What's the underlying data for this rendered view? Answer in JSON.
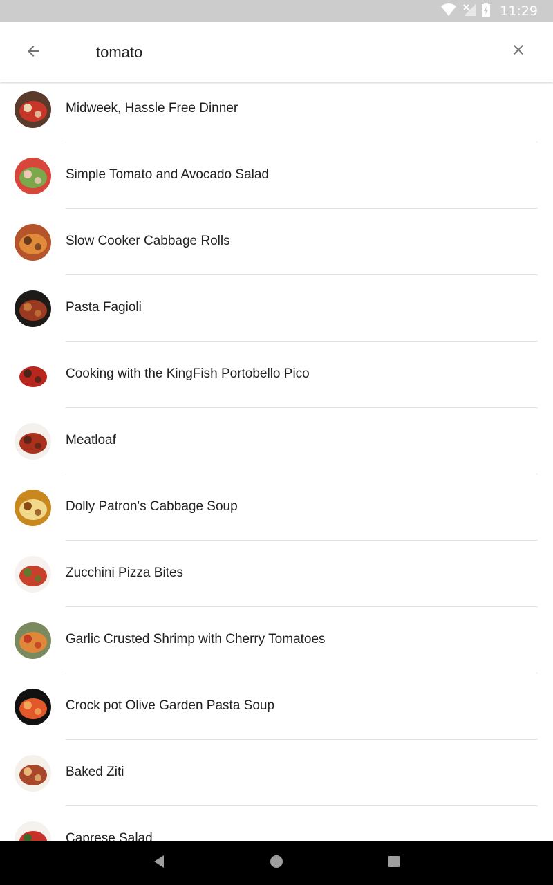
{
  "status_bar": {
    "time": "11:29",
    "icons": [
      "wifi-icon",
      "no-signal-icon",
      "battery-charging-icon"
    ]
  },
  "search": {
    "query": "tomato",
    "back_icon": "arrow-back-icon",
    "clear_icon": "close-icon"
  },
  "results": [
    {
      "title": "Midweek, Hassle Free Dinner",
      "thumb_colors": [
        "#5a3a2a",
        "#c8362a",
        "#e8d7b0"
      ]
    },
    {
      "title": "Simple Tomato and Avocado Salad",
      "thumb_colors": [
        "#d8453a",
        "#7aa84a",
        "#f0c8b8"
      ]
    },
    {
      "title": "Slow Cooker Cabbage Rolls",
      "thumb_colors": [
        "#b5542a",
        "#e08a3a",
        "#6a3a1e"
      ]
    },
    {
      "title": "Pasta Fagioli",
      "thumb_colors": [
        "#1e1a18",
        "#9a3a22",
        "#c6763a"
      ]
    },
    {
      "title": "Cooking with the KingFish Portobello Pico",
      "thumb_colors": [
        "#ffffff",
        "#b8261e",
        "#4a2418"
      ]
    },
    {
      "title": "Meatloaf",
      "thumb_colors": [
        "#f4f0ec",
        "#a8321e",
        "#5e2416"
      ]
    },
    {
      "title": "Dolly Patron's Cabbage Soup",
      "thumb_colors": [
        "#c9881e",
        "#f1d88a",
        "#8a4a12"
      ]
    },
    {
      "title": "Zucchini Pizza Bites",
      "thumb_colors": [
        "#f7f2ee",
        "#c8402c",
        "#5d7a2e"
      ]
    },
    {
      "title": "Garlic Crusted Shrimp with Cherry Tomatoes",
      "thumb_colors": [
        "#7a8a5e",
        "#e0883a",
        "#c23a22"
      ]
    },
    {
      "title": "Crock pot Olive Garden Pasta Soup",
      "thumb_colors": [
        "#111111",
        "#e2582a",
        "#f2a55a"
      ]
    },
    {
      "title": "Baked Ziti",
      "thumb_colors": [
        "#f5f0ea",
        "#a8482a",
        "#e8b87a"
      ]
    },
    {
      "title": "Caprese Salad",
      "thumb_colors": [
        "#f5f2ee",
        "#c8302a",
        "#3a6a2a"
      ]
    }
  ],
  "nav_bar": {
    "icons": [
      "nav-back-icon",
      "nav-home-icon",
      "nav-recents-icon"
    ]
  },
  "colors": {
    "status_bar_bg": "#cccccc",
    "app_bar_bg": "#ffffff",
    "text_primary": "#212121",
    "divider": "#e0e0e0",
    "nav_bar_bg": "#000000"
  }
}
